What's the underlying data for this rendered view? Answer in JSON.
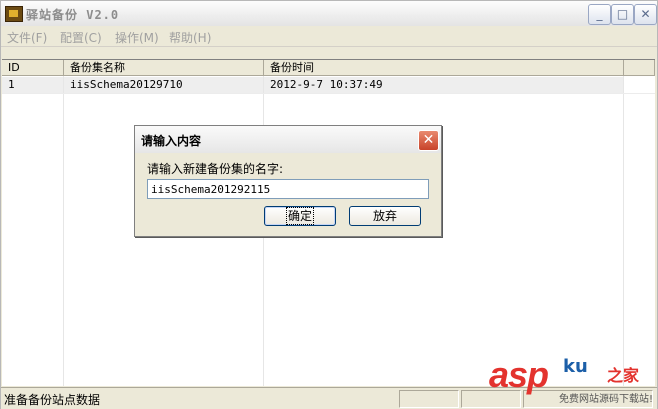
{
  "window": {
    "title": "驿站备份 V2.0",
    "buttons": {
      "minimize": "_",
      "maximize": "□",
      "close": "✕"
    }
  },
  "menu": [
    {
      "label": "文件(F)"
    },
    {
      "label": "配置(C)"
    },
    {
      "label": "操作(M)"
    },
    {
      "label": "帮助(H)"
    }
  ],
  "table": {
    "columns": [
      "ID",
      "备份集名称",
      "备份时间"
    ],
    "rows": [
      {
        "id": "1",
        "name": "iisSchema20129710",
        "time": "2012-9-7 10:37:49"
      }
    ]
  },
  "dialog": {
    "title": "请输入内容",
    "close": "✕",
    "prompt": "请输入新建备份集的名字:",
    "input_value": "iisSchema201292115",
    "ok_label": "确定",
    "cancel_label": "放弃"
  },
  "status": {
    "text": "准备备份站点数据"
  },
  "watermark": {
    "asp": "asp",
    "ku": "ku",
    "zhijia": "之家",
    "sub": "免费网站源码下载站!"
  }
}
